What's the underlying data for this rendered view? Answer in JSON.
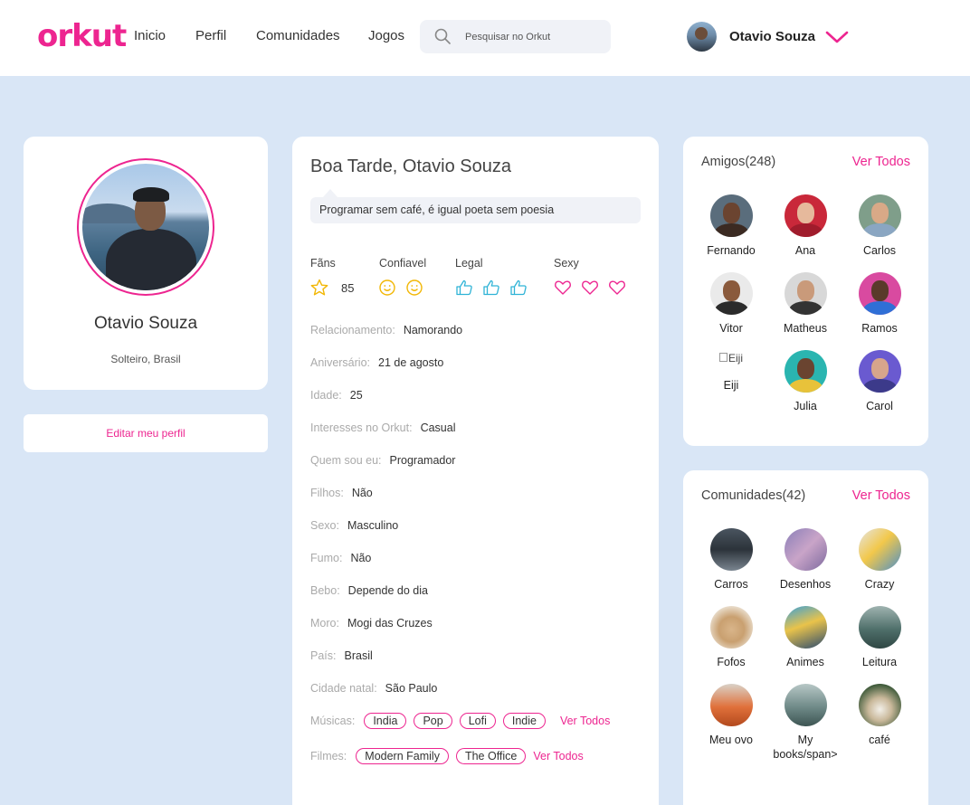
{
  "header": {
    "logo": "orkut",
    "nav": [
      "Inicio",
      "Perfil",
      "Comunidades",
      "Jogos"
    ],
    "search_placeholder": "Pesquisar no Orkut",
    "user_name": "Otavio Souza"
  },
  "profile": {
    "name": "Otavio Souza",
    "subtitle": "Solteiro, Brasil",
    "edit_label": "Editar meu perfil"
  },
  "main": {
    "greeting": "Boa Tarde, Otavio Souza",
    "quote": "Programar sem café, é igual poeta sem poesia",
    "ratings": {
      "fans_label": "Fãns",
      "fans_count": "85",
      "confiavel_label": "Confiavel",
      "confiavel_level": 2,
      "legal_label": "Legal",
      "legal_level": 3,
      "sexy_label": "Sexy",
      "sexy_level": 3
    },
    "fields": [
      {
        "key": "Relacionamento:",
        "value": "Namorando"
      },
      {
        "key": "Aniversário:",
        "value": "21 de agosto"
      },
      {
        "key": "Idade:",
        "value": "25"
      },
      {
        "key": "Interesses no Orkut:",
        "value": "Casual"
      },
      {
        "key": "Quem sou eu:",
        "value": "Programador"
      },
      {
        "key": "Filhos:",
        "value": "Não"
      },
      {
        "key": "Sexo:",
        "value": "Masculino"
      },
      {
        "key": "Fumo:",
        "value": "Não"
      },
      {
        "key": "Bebo:",
        "value": "Depende do dia"
      },
      {
        "key": "Moro:",
        "value": "Mogi das Cruzes"
      },
      {
        "key": "País:",
        "value": "Brasil"
      },
      {
        "key": "Cidade natal:",
        "value": "São Paulo"
      }
    ],
    "musicas": {
      "label": "Músicas:",
      "tags": [
        "India",
        "Pop",
        "Lofi",
        "Indie"
      ],
      "link": "Ver Todos"
    },
    "filmes": {
      "label": "Filmes:",
      "tags": [
        "Modern Family",
        "The Office"
      ],
      "link": "Ver Todos"
    }
  },
  "friends": {
    "title": "Amigos(248)",
    "link": "Ver Todos",
    "items": [
      {
        "name": "Fernando"
      },
      {
        "name": "Ana"
      },
      {
        "name": "Carlos"
      },
      {
        "name": "Vitor"
      },
      {
        "name": "Matheus"
      },
      {
        "name": "Ramos"
      },
      {
        "name": "Eiji",
        "broken_alt": "Eiji"
      },
      {
        "name": "Julia"
      },
      {
        "name": "Carol"
      }
    ]
  },
  "communities": {
    "title": "Comunidades(42)",
    "link": "Ver Todos",
    "items": [
      {
        "name": "Carros"
      },
      {
        "name": "Desenhos"
      },
      {
        "name": "Crazy"
      },
      {
        "name": "Fofos"
      },
      {
        "name": "Animes"
      },
      {
        "name": "Leitura"
      },
      {
        "name": "Meu ovo"
      },
      {
        "name": "My books/span>"
      },
      {
        "name": "café"
      }
    ]
  },
  "colors": {
    "accent": "#ed2590",
    "background": "#d9e6f6",
    "icon_blue": "#2fb3d6",
    "icon_yellow": "#f2b705"
  }
}
